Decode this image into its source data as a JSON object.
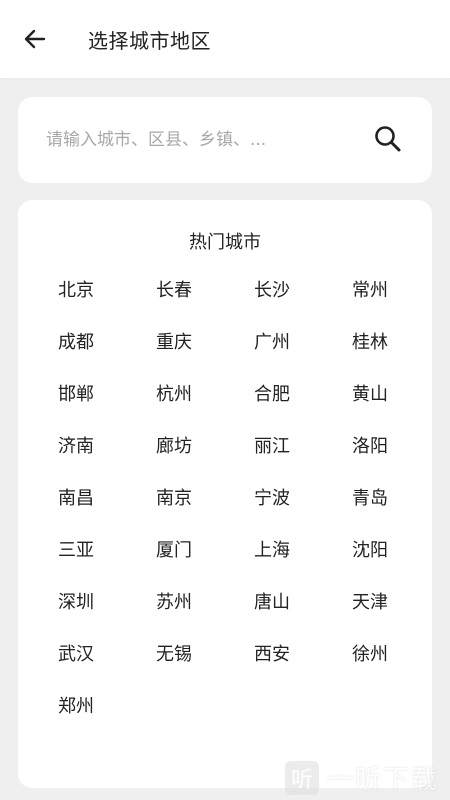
{
  "header": {
    "title": "选择城市地区",
    "back_icon": "arrow-left-icon"
  },
  "search": {
    "placeholder": "请输入城市、区县、乡镇、...",
    "value": "",
    "icon": "search-icon"
  },
  "hot_cities": {
    "title": "热门城市",
    "items": [
      "北京",
      "长春",
      "长沙",
      "常州",
      "成都",
      "重庆",
      "广州",
      "桂林",
      "邯郸",
      "杭州",
      "合肥",
      "黄山",
      "济南",
      "廊坊",
      "丽江",
      "洛阳",
      "南昌",
      "南京",
      "宁波",
      "青岛",
      "三亚",
      "厦门",
      "上海",
      "沈阳",
      "深圳",
      "苏州",
      "唐山",
      "天津",
      "武汉",
      "无锡",
      "西安",
      "徐州",
      "郑州"
    ]
  },
  "watermark": {
    "logo_char": "听",
    "text": "一听下载"
  },
  "colors": {
    "page_bg": "#efefef",
    "card_bg": "#ffffff",
    "text": "#222222",
    "placeholder": "#a8a8a8"
  }
}
